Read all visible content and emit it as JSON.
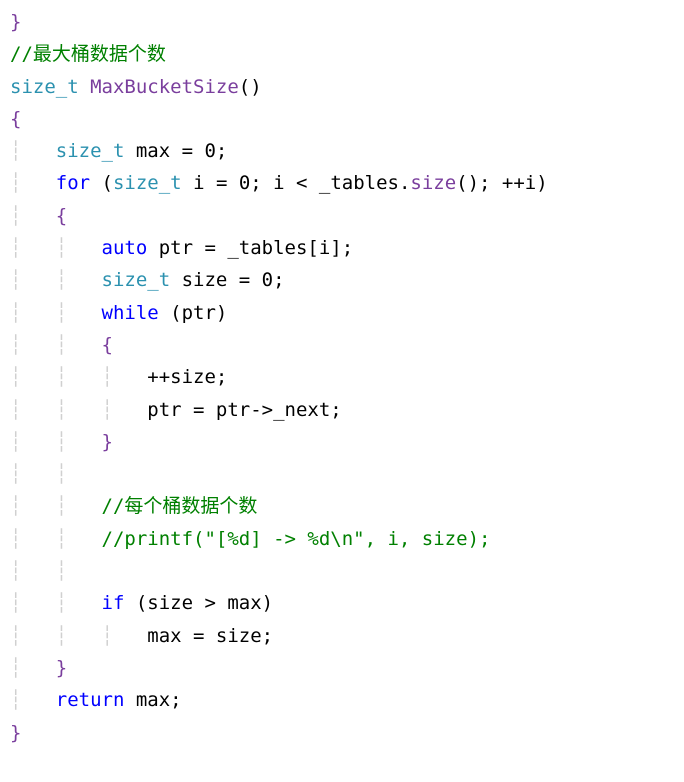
{
  "code": {
    "line0": "}",
    "line1_comment": "//最大桶数据个数",
    "line2_type": "size_t",
    "line2_func": " MaxBucketSize",
    "line2_paren": "()",
    "line3": "{",
    "line4_indent": "    ",
    "line4_type": "size_t",
    "line4_rest": " max = 0;",
    "line5_indent": "    ",
    "line5_for": "for",
    "line5_paren": " (",
    "line5_type": "size_t",
    "line5_mid": " i = 0; i < _tables.",
    "line5_size": "size",
    "line5_end": "(); ++i)",
    "line6_indent": "    ",
    "line6": "{",
    "line7_indent": "        ",
    "line7_auto": "auto",
    "line7_rest": " ptr = _tables[i];",
    "line8_indent": "        ",
    "line8_type": "size_t",
    "line8_rest": " size = 0;",
    "line9_indent": "        ",
    "line9_while": "while",
    "line9_rest": " (ptr)",
    "line10_indent": "        ",
    "line10": "{",
    "line11_indent": "            ",
    "line11": "++size;",
    "line12_indent": "            ",
    "line12": "ptr = ptr->_next;",
    "line13_indent": "        ",
    "line13": "}",
    "line14_blank": "        ",
    "line15_indent": "        ",
    "line15_comment": "//每个桶数据个数",
    "line16_indent": "        ",
    "line16_comment": "//printf(\"[%d] -> %d\\n\", i, size);",
    "line17_blank": "        ",
    "line18_indent": "        ",
    "line18_if": "if",
    "line18_rest": " (size > max)",
    "line19_indent": "            ",
    "line19": "max = size;",
    "line20_indent": "    ",
    "line20": "}",
    "line21_indent": "    ",
    "line21_return": "return",
    "line21_rest": " max;",
    "line22": "}"
  }
}
